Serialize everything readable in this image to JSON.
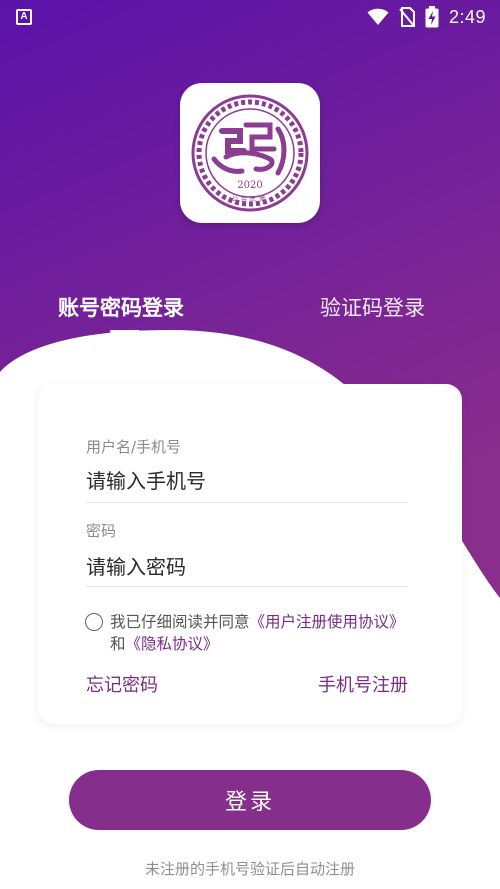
{
  "status_bar": {
    "left_badge": "A",
    "time": "2:49"
  },
  "logo": {
    "year": "2020",
    "caption": "公共民博"
  },
  "tabs": {
    "account_login": "账号密码登录",
    "code_login": "验证码登录"
  },
  "form": {
    "username_label": "用户名/手机号",
    "username_placeholder": "请输入手机号",
    "password_label": "密码",
    "password_placeholder": "请输入密码"
  },
  "agreement": {
    "prefix": "我已仔细阅读并同意",
    "user_agreement": "《用户注册使用协议》",
    "conjunction": "和",
    "privacy_policy": "《隐私协议》"
  },
  "links": {
    "forgot_password": "忘记密码",
    "phone_register": "手机号注册"
  },
  "login_button": "登录",
  "footer_note": "未注册的手机号验证后自动注册",
  "colors": {
    "gradient_top": "#5a12a8",
    "gradient_bottom": "#8a2e8c",
    "accent": "#862e8b",
    "link": "#7a2b86"
  }
}
